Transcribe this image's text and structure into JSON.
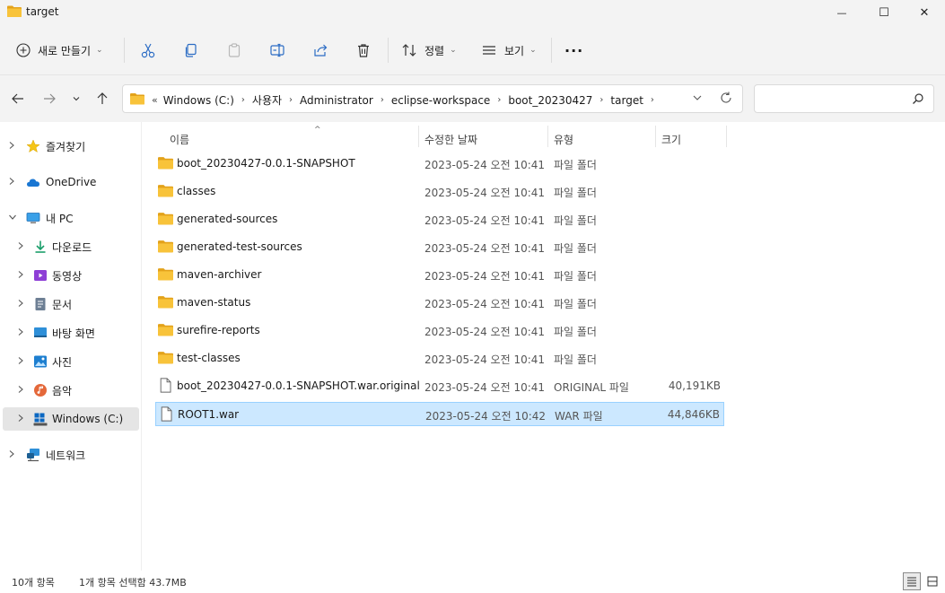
{
  "window": {
    "title": "target",
    "minimize_glyph": "—",
    "maximize_glyph": "☐",
    "close_glyph": "✕"
  },
  "toolbar": {
    "new_label": "새로 만들기",
    "sort_label": "정렬",
    "view_label": "보기",
    "more_label": "···",
    "caret": "⌄"
  },
  "address": {
    "lead": "«",
    "crumbs": [
      "Windows (C:)",
      "사용자",
      "Administrator",
      "eclipse-workspace",
      "boot_20230427",
      "target"
    ],
    "separator": "›",
    "search_placeholder": ""
  },
  "sidebar": {
    "items": [
      {
        "label": "즐겨찾기",
        "icon": "star-icon"
      },
      {
        "label": "OneDrive",
        "icon": "cloud-icon"
      },
      {
        "label": "내 PC",
        "icon": "pc-icon"
      },
      {
        "label": "다운로드",
        "icon": "download-icon"
      },
      {
        "label": "동영상",
        "icon": "video-icon"
      },
      {
        "label": "문서",
        "icon": "document-icon"
      },
      {
        "label": "바탕 화면",
        "icon": "desktop-icon"
      },
      {
        "label": "사진",
        "icon": "picture-icon"
      },
      {
        "label": "음악",
        "icon": "music-icon"
      },
      {
        "label": "Windows (C:)",
        "icon": "drive-icon"
      },
      {
        "label": "네트워크",
        "icon": "network-icon"
      }
    ],
    "chevron_right": "›",
    "chevron_down": "⌄"
  },
  "columns": {
    "name": "이름",
    "date": "수정한 날짜",
    "type": "유형",
    "size": "크기",
    "sort_indicator": "^"
  },
  "files": [
    {
      "name": "boot_20230427-0.0.1-SNAPSHOT",
      "date": "2023-05-24 오전 10:41",
      "type": "파일 폴더",
      "size": "",
      "kind": "folder"
    },
    {
      "name": "classes",
      "date": "2023-05-24 오전 10:41",
      "type": "파일 폴더",
      "size": "",
      "kind": "folder"
    },
    {
      "name": "generated-sources",
      "date": "2023-05-24 오전 10:41",
      "type": "파일 폴더",
      "size": "",
      "kind": "folder"
    },
    {
      "name": "generated-test-sources",
      "date": "2023-05-24 오전 10:41",
      "type": "파일 폴더",
      "size": "",
      "kind": "folder"
    },
    {
      "name": "maven-archiver",
      "date": "2023-05-24 오전 10:41",
      "type": "파일 폴더",
      "size": "",
      "kind": "folder"
    },
    {
      "name": "maven-status",
      "date": "2023-05-24 오전 10:41",
      "type": "파일 폴더",
      "size": "",
      "kind": "folder"
    },
    {
      "name": "surefire-reports",
      "date": "2023-05-24 오전 10:41",
      "type": "파일 폴더",
      "size": "",
      "kind": "folder"
    },
    {
      "name": "test-classes",
      "date": "2023-05-24 오전 10:41",
      "type": "파일 폴더",
      "size": "",
      "kind": "folder"
    },
    {
      "name": "boot_20230427-0.0.1-SNAPSHOT.war.original",
      "date": "2023-05-24 오전 10:41",
      "type": "ORIGINAL 파일",
      "size": "40,191KB",
      "kind": "file"
    },
    {
      "name": "ROOT1.war",
      "date": "2023-05-24 오전 10:42",
      "type": "WAR 파일",
      "size": "44,846KB",
      "kind": "file",
      "selected": true
    }
  ],
  "status": {
    "count": "10개 항목",
    "selection": "1개 항목 선택함 43.7MB"
  },
  "colors": {
    "folder": "#f8c33a",
    "folder_dark": "#e3a21a",
    "selection_bg": "#cce8ff",
    "selection_border": "#99d1ff",
    "chrome_bg": "#f3f3f3"
  }
}
